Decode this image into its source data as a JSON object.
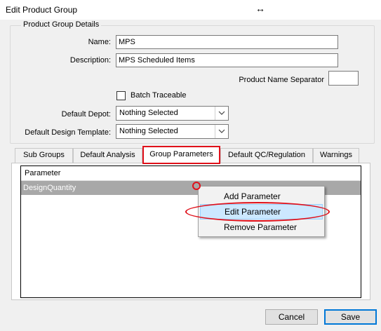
{
  "window": {
    "title": "Edit Product Group",
    "resize_glyph": "↔"
  },
  "details": {
    "group_title": "Product Group Details",
    "name_label": "Name:",
    "name_value": "MPS",
    "description_label": "Description:",
    "description_value": "MPS Scheduled Items",
    "separator_label": "Product Name Separator",
    "separator_value": "",
    "batch_traceable_label": "Batch Traceable",
    "batch_traceable_checked": false,
    "default_depot_label": "Default Depot:",
    "default_depot_value": "Nothing Selected",
    "default_design_template_label": "Default Design Template:",
    "default_design_template_value": "Nothing Selected"
  },
  "tabs": [
    {
      "label": "Sub Groups",
      "active": false
    },
    {
      "label": "Default Analysis",
      "active": false
    },
    {
      "label": "Group Parameters",
      "active": true
    },
    {
      "label": "Default QC/Regulation",
      "active": false
    },
    {
      "label": "Warnings",
      "active": false
    }
  ],
  "grid": {
    "header": "Parameter",
    "rows": [
      {
        "value": "DesignQuantity",
        "selected": true
      }
    ]
  },
  "context_menu": {
    "items": [
      {
        "label": "Add Parameter",
        "highlighted": false
      },
      {
        "label": "Edit Parameter",
        "highlighted": true
      },
      {
        "label": "Remove Parameter",
        "highlighted": false
      }
    ]
  },
  "buttons": {
    "cancel_label": "Cancel",
    "save_label": "Save"
  },
  "colors": {
    "annotation_red": "#e0101a",
    "menu_highlight": "#cce8ff",
    "selected_row": "#a8a8a8",
    "default_button_border": "#0078d7"
  }
}
